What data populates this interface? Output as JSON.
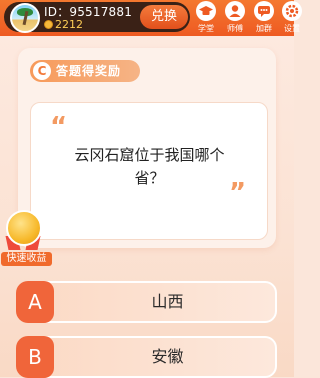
{
  "header": {
    "user_id": "ID：95517881",
    "coins": "2212",
    "exchange_label": "兑换",
    "nav": [
      {
        "label": "学堂",
        "icon": "graduation-cap-icon"
      },
      {
        "label": "师傅",
        "icon": "person-icon"
      },
      {
        "label": "加群",
        "icon": "chat-icon"
      },
      {
        "label": "设置",
        "icon": "gear-icon"
      }
    ]
  },
  "quiz": {
    "banner": "答题得奖励",
    "question": "云冈石窟位于我国哪个省？",
    "options": [
      {
        "letter": "A",
        "text": "山西"
      },
      {
        "letter": "B",
        "text": "安徽"
      }
    ]
  },
  "reward": {
    "quick_label": "快速收益"
  },
  "colors": {
    "accent": "#ee5a22",
    "option_letter": "#f0653a",
    "dark_pill": "#3a2116"
  }
}
